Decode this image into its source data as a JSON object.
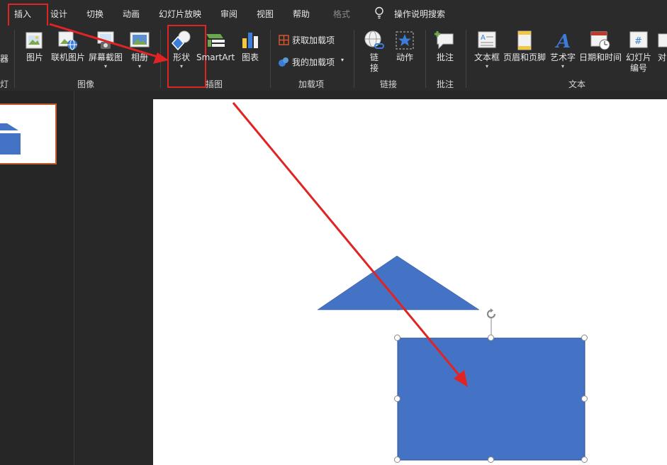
{
  "tabs": [
    "插入",
    "设计",
    "切换",
    "动画",
    "幻灯片放映",
    "审阅",
    "视图",
    "帮助",
    "格式"
  ],
  "tell_me": "操作说明搜索",
  "ribbon": {
    "images": {
      "picture": "图片",
      "online_picture": "联机图片",
      "screenshot": "屏幕截图",
      "album": "相册",
      "group": "图像"
    },
    "illustrations": {
      "shapes": "形状",
      "smartart": "SmartArt",
      "chart": "图表",
      "group": "插图"
    },
    "addins": {
      "get": "获取加载项",
      "mine": "我的加载项",
      "group": "加载项"
    },
    "links": {
      "link_line1": "链",
      "link_line2": "接",
      "action": "动作",
      "group": "链接"
    },
    "comments": {
      "comment": "批注",
      "group": "批注"
    },
    "text": {
      "textbox": "文本框",
      "header_footer": "页眉和页脚",
      "wordart": "艺术字",
      "datetime": "日期和时间",
      "slide_num_line1": "幻灯片",
      "slide_num_line2": "编号",
      "object_partial": "对",
      "group": "文本"
    },
    "partial_left_label": "器",
    "partial_group_left": "灯"
  },
  "colors": {
    "accent_red": "#e02424",
    "shape_blue": "#4472c4",
    "ribbon_bg": "#2b2b2b"
  }
}
